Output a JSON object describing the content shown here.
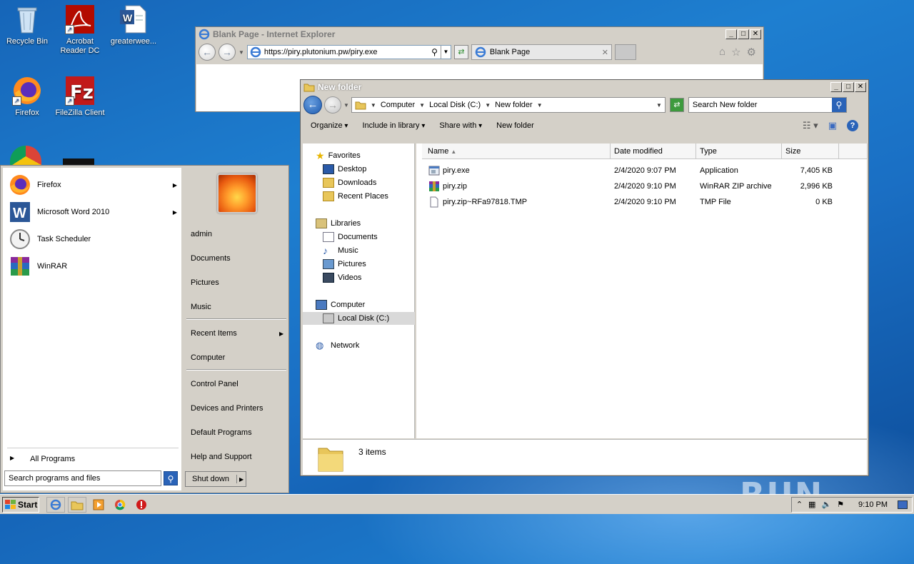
{
  "desktop": {
    "icons": [
      {
        "label": "Recycle Bin",
        "icon": "recycle-bin-icon"
      },
      {
        "label": "Acrobat Reader DC",
        "icon": "acrobat-icon"
      },
      {
        "label": "greaterwee...",
        "icon": "word-doc-icon"
      },
      {
        "label": "Firefox",
        "icon": "firefox-icon"
      },
      {
        "label": "FileZilla Client",
        "icon": "filezilla-icon"
      }
    ]
  },
  "ie": {
    "title": "Blank Page - Internet Explorer",
    "address": "https://piry.plutonium.pw/piry.exe",
    "tab_label": "Blank Page"
  },
  "explorer": {
    "title": "New folder",
    "breadcrumb": [
      "Computer",
      "Local Disk (C:)",
      "New folder"
    ],
    "search_placeholder": "Search New folder",
    "commands": [
      "Organize",
      "Include in library",
      "Share with",
      "New folder"
    ],
    "nav": {
      "favorites": "Favorites",
      "favorites_items": [
        "Desktop",
        "Downloads",
        "Recent Places"
      ],
      "libraries": "Libraries",
      "libraries_items": [
        "Documents",
        "Music",
        "Pictures",
        "Videos"
      ],
      "computer": "Computer",
      "computer_items": [
        "Local Disk (C:)"
      ],
      "network": "Network"
    },
    "columns": [
      "Name",
      "Date modified",
      "Type",
      "Size"
    ],
    "files": [
      {
        "name": "piry.exe",
        "date": "2/4/2020 9:07 PM",
        "type": "Application",
        "size": "7,405 KB"
      },
      {
        "name": "piry.zip",
        "date": "2/4/2020 9:10 PM",
        "type": "WinRAR ZIP archive",
        "size": "2,996 KB"
      },
      {
        "name": "piry.zip~RFa97818.TMP",
        "date": "2/4/2020 9:10 PM",
        "type": "TMP File",
        "size": "0 KB"
      }
    ],
    "status": "3 items"
  },
  "start_menu": {
    "programs": [
      "Firefox",
      "Microsoft Word 2010",
      "Task Scheduler",
      "WinRAR"
    ],
    "all_programs": "All Programs",
    "search_placeholder": "Search programs and files",
    "right_links": [
      "admin",
      "Documents",
      "Pictures",
      "Music",
      "Recent Items",
      "Computer",
      "Control Panel",
      "Devices and Printers",
      "Default Programs",
      "Help and Support"
    ],
    "shutdown": "Shut down"
  },
  "taskbar": {
    "start": "Start",
    "clock": "9:10 PM"
  },
  "watermark": "ANY RUN"
}
